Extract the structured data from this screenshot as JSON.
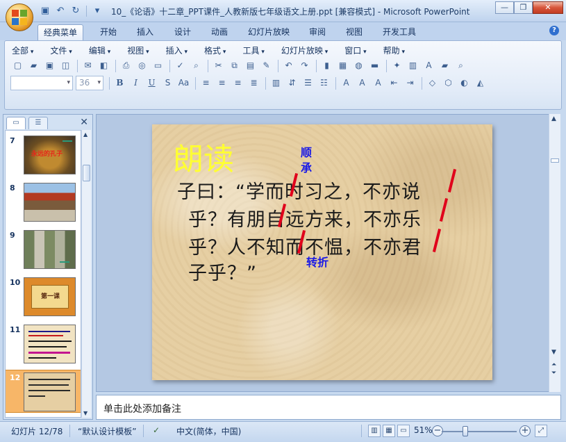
{
  "window": {
    "title": "10_《论语》十二章_PPT课件_人教新版七年级语文上册.ppt [兼容模式] - Microsoft PowerPoint",
    "controls": [
      "minimize",
      "restore",
      "close"
    ]
  },
  "ribbon_tabs": [
    "经典菜单",
    "开始",
    "插入",
    "设计",
    "动画",
    "幻灯片放映",
    "审阅",
    "视图",
    "开发工具"
  ],
  "active_tab": "经典菜单",
  "classic_menus": [
    "全部",
    "文件",
    "编辑",
    "视图",
    "插入",
    "格式",
    "工具",
    "幻灯片放映",
    "窗口",
    "帮助"
  ],
  "font": {
    "name": "",
    "size": "36"
  },
  "thumbnails": [
    {
      "num": "7",
      "caption": "永远的孔子",
      "style": "gold"
    },
    {
      "num": "8",
      "caption": "",
      "style": "temple"
    },
    {
      "num": "9",
      "caption": "",
      "style": "garden"
    },
    {
      "num": "10",
      "caption": "第一课",
      "style": "scroll"
    },
    {
      "num": "11",
      "caption": "",
      "style": "text"
    },
    {
      "num": "12",
      "caption": "",
      "style": "text-dark",
      "selected": true
    }
  ],
  "slide": {
    "title": "朗读",
    "annotation_top": [
      "顺",
      "承"
    ],
    "annotation_bottom": "转折",
    "lines": [
      "子曰：“学而时习之，不亦说",
      "乎？有朋自远方来，不亦乐",
      "乎？人不知而不愠，不亦君",
      "子乎？”"
    ]
  },
  "notes_placeholder": "单击此处添加备注",
  "status": {
    "slide_counter": "幻灯片 12/78",
    "template": "“默认设计模板”",
    "language": "中文(简体，中国)",
    "zoom": "51%"
  },
  "colors": {
    "title_yellow": "#ffff33",
    "annotation_blue": "#1a1ae6",
    "slash_red": "#e0001b",
    "selected_thumb": "#f7b668"
  }
}
